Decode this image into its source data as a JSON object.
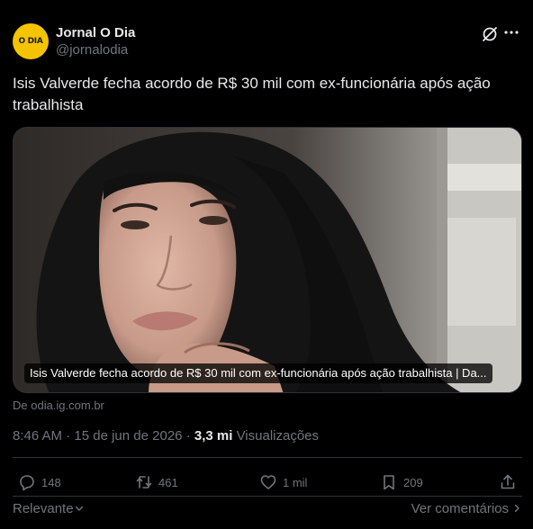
{
  "author": {
    "display_name": "Jornal O Dia",
    "handle": "@jornalodia",
    "avatar_text": "O DIA",
    "avatar_color": "#f5c400"
  },
  "header_icons": {
    "grok": "grok-slash-icon",
    "more": "more-dots-icon"
  },
  "tweet": {
    "text": "Isis Valverde fecha acordo de R$ 30 mil com ex-funcionária após ação trabalhista"
  },
  "card": {
    "caption": "Isis Valverde fecha acordo de R$ 30 mil com ex-funcionária após ação trabalhista | Da...",
    "source": "De odia.ig.com.br"
  },
  "meta": {
    "time": "8:46 AM",
    "separator": "·",
    "date": "15 de jun de 2026",
    "views_count": "3,3 mi",
    "views_label": "Visualizações"
  },
  "actions": {
    "replies": "148",
    "reposts": "461",
    "likes": "1 mil",
    "bookmarks": "209"
  },
  "footer": {
    "sort_label": "Relevante",
    "see_replies": "Ver comentários"
  },
  "colors": {
    "background": "#000000",
    "text": "#e7e9ea",
    "muted": "#71767b",
    "border": "#2f3336"
  }
}
